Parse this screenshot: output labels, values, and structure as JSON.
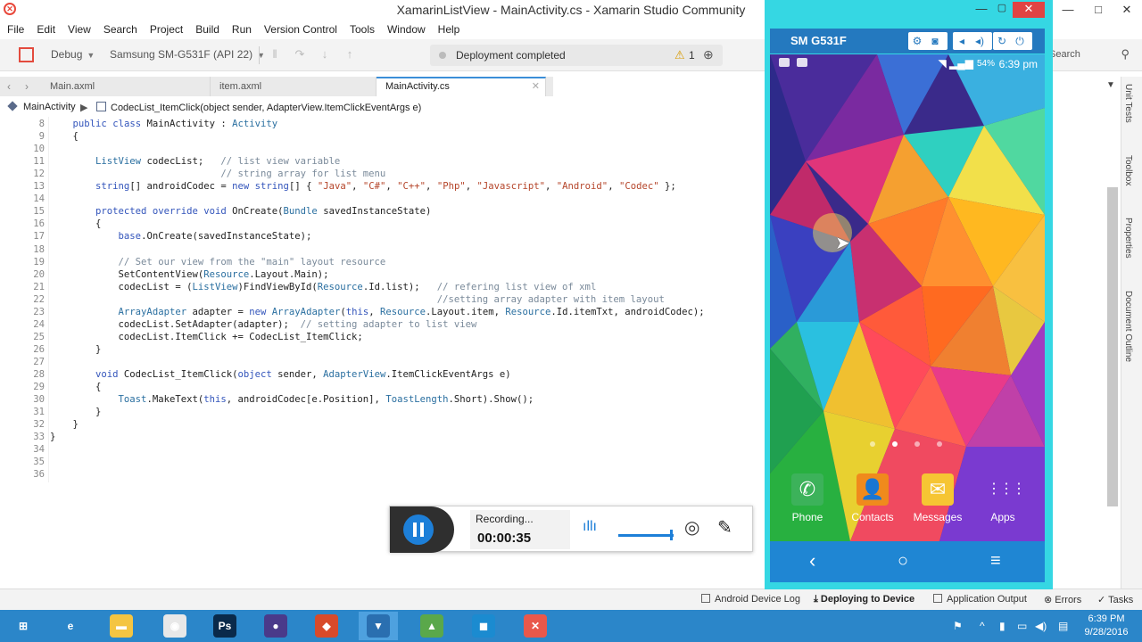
{
  "window": {
    "title": "XamarinListView - MainActivity.cs - Xamarin Studio Community",
    "minimize": "—",
    "maximize": "□",
    "close": "✕"
  },
  "menu": [
    "File",
    "Edit",
    "View",
    "Search",
    "Project",
    "Build",
    "Run",
    "Version Control",
    "Tools",
    "Window",
    "Help"
  ],
  "toolbar": {
    "config": "Debug",
    "device": "Samsung SM-G531F (API 22)",
    "status_message": "Deployment completed",
    "warning_count": "1",
    "search_placeholder": "Search"
  },
  "tabs": [
    {
      "label": "Main.axml"
    },
    {
      "label": "item.axml"
    },
    {
      "label": "MainActivity.cs",
      "active": true
    }
  ],
  "breadcrumb": {
    "class": "MainActivity",
    "member": "CodecList_ItemClick(object sender, AdapterView.ItemClickEventArgs e)"
  },
  "editor": {
    "lines": [
      {
        "n": "8",
        "text": "    public class MainActivity : Activity"
      },
      {
        "n": "9",
        "text": "    {"
      },
      {
        "n": "10",
        "text": ""
      },
      {
        "n": "11",
        "text": "        ListView codecList;   // list view variable"
      },
      {
        "n": "12",
        "text": "                              // string array for list menu"
      },
      {
        "n": "13",
        "text": "        string[] androidCodec = new string[] { \"Java\", \"C#\", \"C++\", \"Php\", \"Javascript\", \"Android\", \"Codec\" };"
      },
      {
        "n": "14",
        "text": ""
      },
      {
        "n": "15",
        "text": "        protected override void OnCreate(Bundle savedInstanceState)"
      },
      {
        "n": "16",
        "text": "        {"
      },
      {
        "n": "17",
        "text": "            base.OnCreate(savedInstanceState);"
      },
      {
        "n": "18",
        "text": ""
      },
      {
        "n": "19",
        "text": "            // Set our view from the \"main\" layout resource"
      },
      {
        "n": "20",
        "text": "            SetContentView(Resource.Layout.Main);"
      },
      {
        "n": "21",
        "text": "            codecList = (ListView)FindViewById(Resource.Id.list);   // refering list view of xml"
      },
      {
        "n": "22",
        "text": "                                                                    //setting array adapter with item layout"
      },
      {
        "n": "23",
        "text": "            ArrayAdapter adapter = new ArrayAdapter(this, Resource.Layout.item, Resource.Id.itemTxt, androidCodec);"
      },
      {
        "n": "24",
        "text": "            codecList.SetAdapter(adapter);  // setting adapter to list view"
      },
      {
        "n": "25",
        "text": "            codecList.ItemClick += CodecList_ItemClick;"
      },
      {
        "n": "26",
        "text": "        }"
      },
      {
        "n": "27",
        "text": ""
      },
      {
        "n": "28",
        "text": "        void CodecList_ItemClick(object sender, AdapterView.ItemClickEventArgs e)"
      },
      {
        "n": "29",
        "text": "        {"
      },
      {
        "n": "30",
        "text": "            Toast.MakeText(this, androidCodec[e.Position], ToastLength.Short).Show();"
      },
      {
        "n": "31",
        "text": "        }"
      },
      {
        "n": "32",
        "text": "    }"
      },
      {
        "n": "33",
        "text": "}"
      },
      {
        "n": "34",
        "text": ""
      },
      {
        "n": "35",
        "text": ""
      },
      {
        "n": "36",
        "text": ""
      }
    ]
  },
  "side_panels": [
    "Unit Tests",
    "Toolbox",
    "Properties",
    "Document Outline"
  ],
  "statusbar": {
    "android_log": "Android Device Log",
    "deploying": "Deploying to Device",
    "app_output": "Application Output",
    "errors": "Errors",
    "tasks": "Tasks"
  },
  "taskbar": {
    "apps": [
      {
        "name": "windows-start",
        "glyph": "⊞"
      },
      {
        "name": "internet-explorer",
        "glyph": "e"
      },
      {
        "name": "file-explorer",
        "glyph": "▬"
      },
      {
        "name": "chrome",
        "glyph": "◉"
      },
      {
        "name": "photoshop",
        "glyph": "Ps"
      },
      {
        "name": "eclipse",
        "glyph": "●"
      },
      {
        "name": "recorder",
        "glyph": "◆"
      },
      {
        "name": "xamarin-emulator",
        "glyph": "▼",
        "active": true
      },
      {
        "name": "android-studio",
        "glyph": "▲"
      },
      {
        "name": "camera-app",
        "glyph": "◼"
      },
      {
        "name": "xamarin-studio",
        "glyph": "✕"
      }
    ],
    "time": "6:39 PM",
    "date": "9/28/2016"
  },
  "emulator": {
    "device_name": "SM G531F",
    "phone_time": "6:39 pm",
    "battery": "54%",
    "dock": [
      {
        "label": "Phone",
        "color": "#3cb25a",
        "glyph": "✆"
      },
      {
        "label": "Contacts",
        "color": "#f08a1c",
        "glyph": "👤"
      },
      {
        "label": "Messages",
        "color": "#f6c533",
        "glyph": "✉"
      },
      {
        "label": "Apps",
        "color": "transparent",
        "glyph": "⋮⋮⋮"
      }
    ]
  },
  "recorder": {
    "status": "Recording...",
    "elapsed": "00:00:35"
  }
}
